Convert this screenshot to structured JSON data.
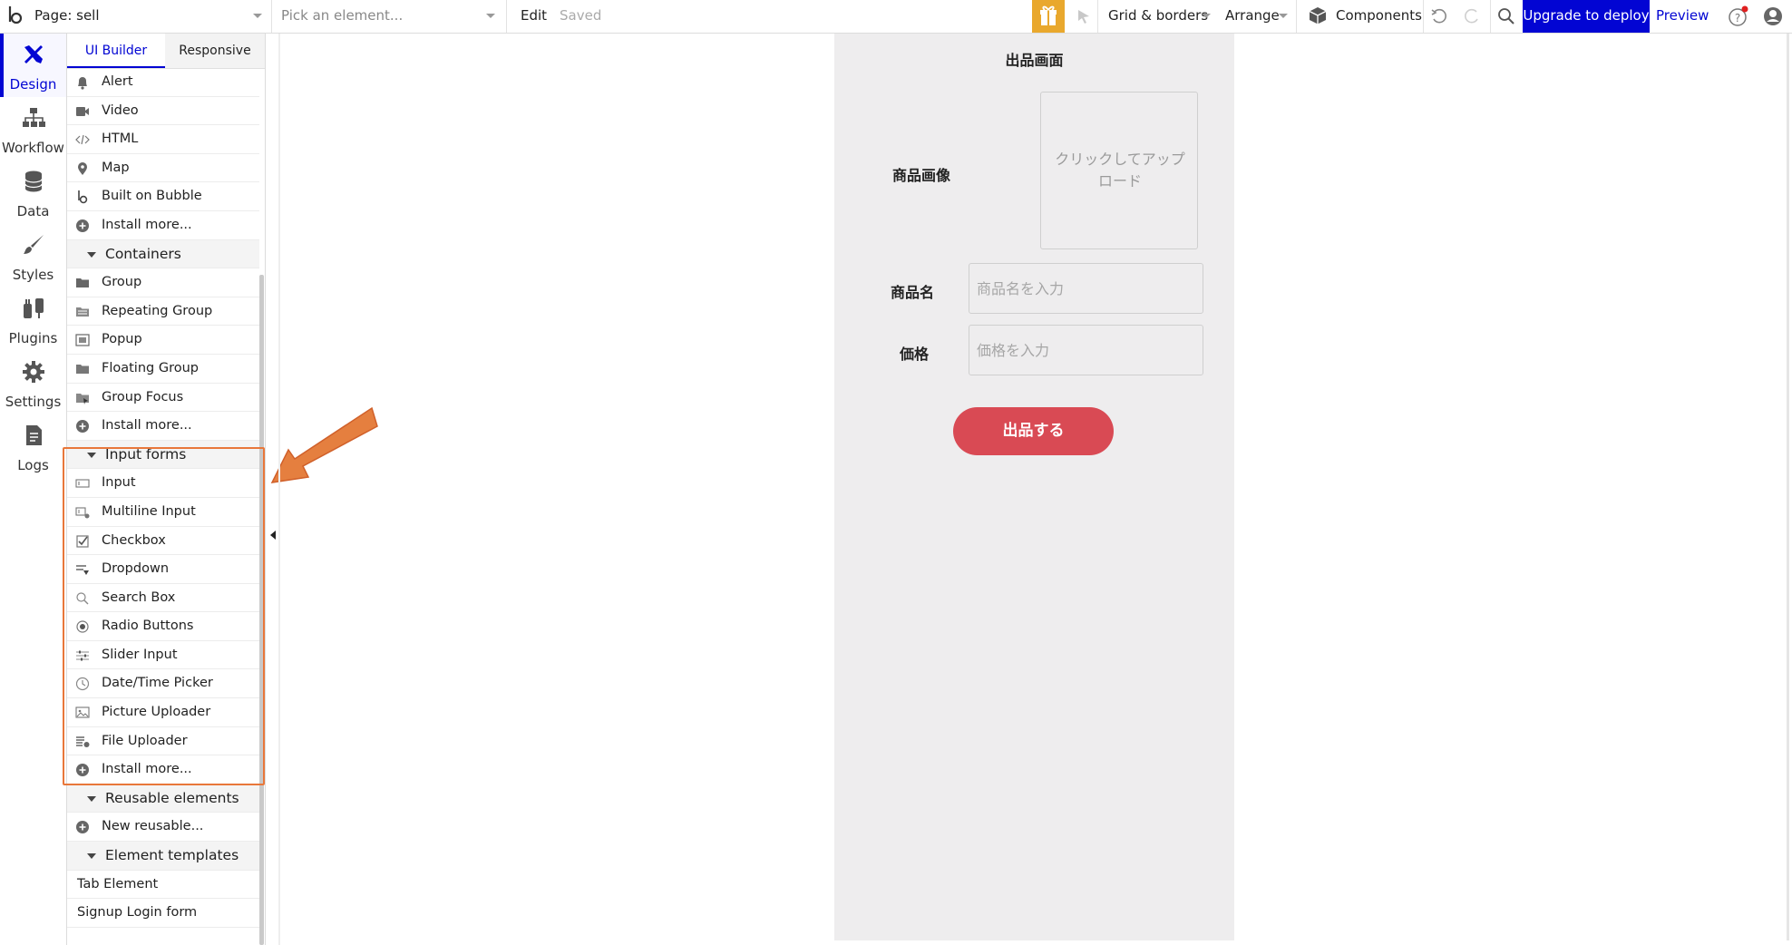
{
  "topbar": {
    "page_label": "Page: sell",
    "element_picker_placeholder": "Pick an element...",
    "edit_label": "Edit",
    "saved_label": "Saved",
    "grid_label": "Grid & borders",
    "arrange_label": "Arrange",
    "components_label": "Components",
    "upgrade_label": "Upgrade to deploy",
    "preview_label": "Preview"
  },
  "rail": {
    "items": [
      {
        "label": "Design",
        "icon": "design-icon"
      },
      {
        "label": "Workflow",
        "icon": "workflow-icon"
      },
      {
        "label": "Data",
        "icon": "database-icon"
      },
      {
        "label": "Styles",
        "icon": "brush-icon"
      },
      {
        "label": "Plugins",
        "icon": "plug-icon"
      },
      {
        "label": "Settings",
        "icon": "gear-icon"
      },
      {
        "label": "Logs",
        "icon": "document-icon"
      }
    ]
  },
  "palette": {
    "tabs": [
      "UI Builder",
      "Responsive"
    ],
    "items": [
      {
        "label": "Alert",
        "icon": "bell-icon"
      },
      {
        "label": "Video",
        "icon": "video-icon"
      },
      {
        "label": "HTML",
        "icon": "code-icon"
      },
      {
        "label": "Map",
        "icon": "map-pin-icon"
      },
      {
        "label": "Built on Bubble",
        "icon": "bubble-logo-icon"
      },
      {
        "label": "Install more...",
        "icon": "plus-circle-icon"
      },
      {
        "label": "Containers",
        "section": true
      },
      {
        "label": "Group",
        "icon": "folder-icon"
      },
      {
        "label": "Repeating Group",
        "icon": "repeating-group-icon"
      },
      {
        "label": "Popup",
        "icon": "popup-icon"
      },
      {
        "label": "Floating Group",
        "icon": "floating-group-icon"
      },
      {
        "label": "Group Focus",
        "icon": "group-focus-icon"
      },
      {
        "label": "Install more...",
        "icon": "plus-circle-icon"
      },
      {
        "label": "Input forms",
        "section": true
      },
      {
        "label": "Input",
        "icon": "input-icon"
      },
      {
        "label": "Multiline Input",
        "icon": "multiline-input-icon"
      },
      {
        "label": "Checkbox",
        "icon": "checkbox-icon"
      },
      {
        "label": "Dropdown",
        "icon": "dropdown-icon"
      },
      {
        "label": "Search Box",
        "icon": "search-icon"
      },
      {
        "label": "Radio Buttons",
        "icon": "radio-icon"
      },
      {
        "label": "Slider Input",
        "icon": "slider-icon"
      },
      {
        "label": "Date/Time Picker",
        "icon": "clock-icon"
      },
      {
        "label": "Picture Uploader",
        "icon": "picture-uploader-icon"
      },
      {
        "label": "File Uploader",
        "icon": "file-uploader-icon"
      },
      {
        "label": "Install more...",
        "icon": "plus-circle-icon"
      },
      {
        "label": "Reusable elements",
        "section": true
      },
      {
        "label": "New reusable...",
        "icon": "plus-circle-icon"
      },
      {
        "label": "Element templates",
        "section": true
      },
      {
        "label": "Tab Element",
        "plain": true
      },
      {
        "label": "Signup Login form",
        "plain": true
      }
    ]
  },
  "canvas": {
    "page_title": "出品画面",
    "image_label": "商品画像",
    "uploader_text": "クリックしてアップロード",
    "name_label": "商品名",
    "name_placeholder": "商品名を入力",
    "price_label": "価格",
    "price_placeholder": "価格を入力",
    "submit_label": "出品する"
  },
  "colors": {
    "accent": "#0205d3",
    "gift": "#e9a82d",
    "highlight": "#e8773a",
    "submit": "#d94a54",
    "page_bg": "#eeedee"
  }
}
